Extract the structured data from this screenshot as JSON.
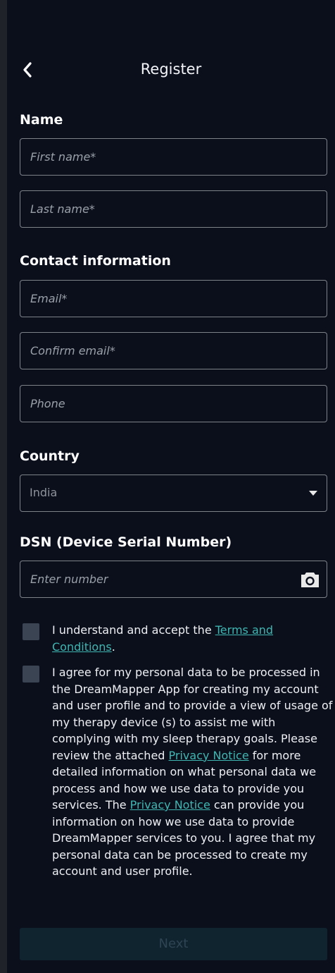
{
  "header": {
    "title": "Register",
    "back_icon": "chevron-left-icon"
  },
  "name_section": {
    "heading": "Name",
    "first_name_placeholder": "First name*",
    "last_name_placeholder": "Last name*"
  },
  "contact_section": {
    "heading": "Contact information",
    "email_placeholder": "Email*",
    "confirm_email_placeholder": "Confirm email*",
    "phone_placeholder": "Phone"
  },
  "country_section": {
    "heading": "Country",
    "selected": "India",
    "dropdown_icon": "caret-down-icon"
  },
  "dsn_section": {
    "heading": "DSN (Device Serial Number)",
    "placeholder": "Enter number",
    "camera_icon": "camera-icon"
  },
  "terms": {
    "text_before": "I understand and accept the ",
    "link": "Terms and Conditions",
    "text_after": "."
  },
  "privacy": {
    "text1": "I agree for my personal data to be processed in the DreamMapper App for creating my account and user profile and to provide a view of usage of my therapy device (s) to assist me with complying with my sleep therapy goals. Please review the attached ",
    "link1": "Privacy Notice",
    "text2": " for more detailed information on what personal data we process and how we use data to provide you services. The ",
    "link2": "Privacy Notice",
    "text3": " can provide you information on how we use data to provide DreamMapper services to you. I agree that my personal data can be processed to create my account and user profile."
  },
  "footer": {
    "next_label": "Next"
  },
  "colors": {
    "background": "#0b0f1c",
    "link": "#3fb6b1",
    "next_button": "#102430",
    "checkbox": "#3a4452"
  }
}
